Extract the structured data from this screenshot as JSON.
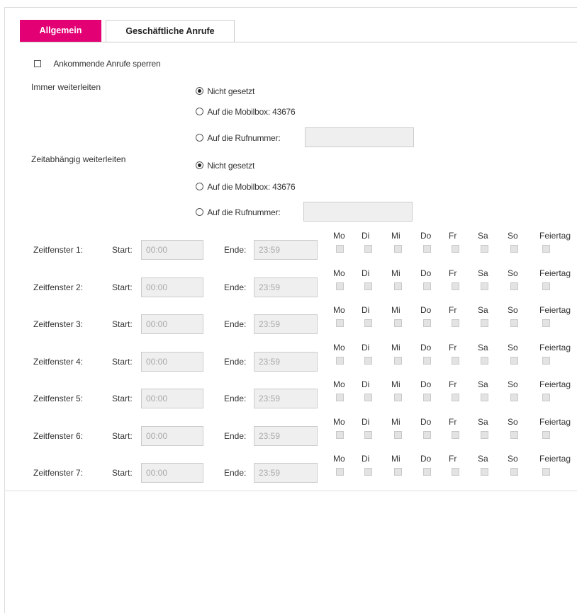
{
  "tabs": [
    {
      "label": "Allgemein",
      "active": true
    },
    {
      "label": "Geschäftliche Anrufe",
      "active": false
    }
  ],
  "block_incoming": {
    "label": "Ankommende Anrufe sperren",
    "checked": false
  },
  "always_forward": {
    "label": "Immer weiterleiten",
    "options": [
      "Nicht gesetzt",
      "Auf die Mobilbox: 43676",
      "Auf die Rufnummer:"
    ],
    "selected": 0,
    "number_value": ""
  },
  "time_forward": {
    "label": "Zeitabhängig weiterleiten",
    "options": [
      "Nicht gesetzt",
      "Auf die Mobilbox: 43676",
      "Auf die Rufnummer:"
    ],
    "selected": 0,
    "number_value": ""
  },
  "time_windows": {
    "start_label": "Start:",
    "end_label": "Ende:",
    "days": [
      "Mo",
      "Di",
      "Mi",
      "Do",
      "Fr",
      "Sa",
      "So",
      "Feiertag"
    ],
    "windows": [
      {
        "label": "Zeitfenster 1:",
        "start": "00:00",
        "end": "23:59"
      },
      {
        "label": "Zeitfenster 2:",
        "start": "00:00",
        "end": "23:59"
      },
      {
        "label": "Zeitfenster 3:",
        "start": "00:00",
        "end": "23:59"
      },
      {
        "label": "Zeitfenster 4:",
        "start": "00:00",
        "end": "23:59"
      },
      {
        "label": "Zeitfenster 5:",
        "start": "00:00",
        "end": "23:59"
      },
      {
        "label": "Zeitfenster 6:",
        "start": "00:00",
        "end": "23:59"
      },
      {
        "label": "Zeitfenster 7:",
        "start": "00:00",
        "end": "23:59"
      }
    ]
  },
  "colors": {
    "accent": "#e20074"
  }
}
